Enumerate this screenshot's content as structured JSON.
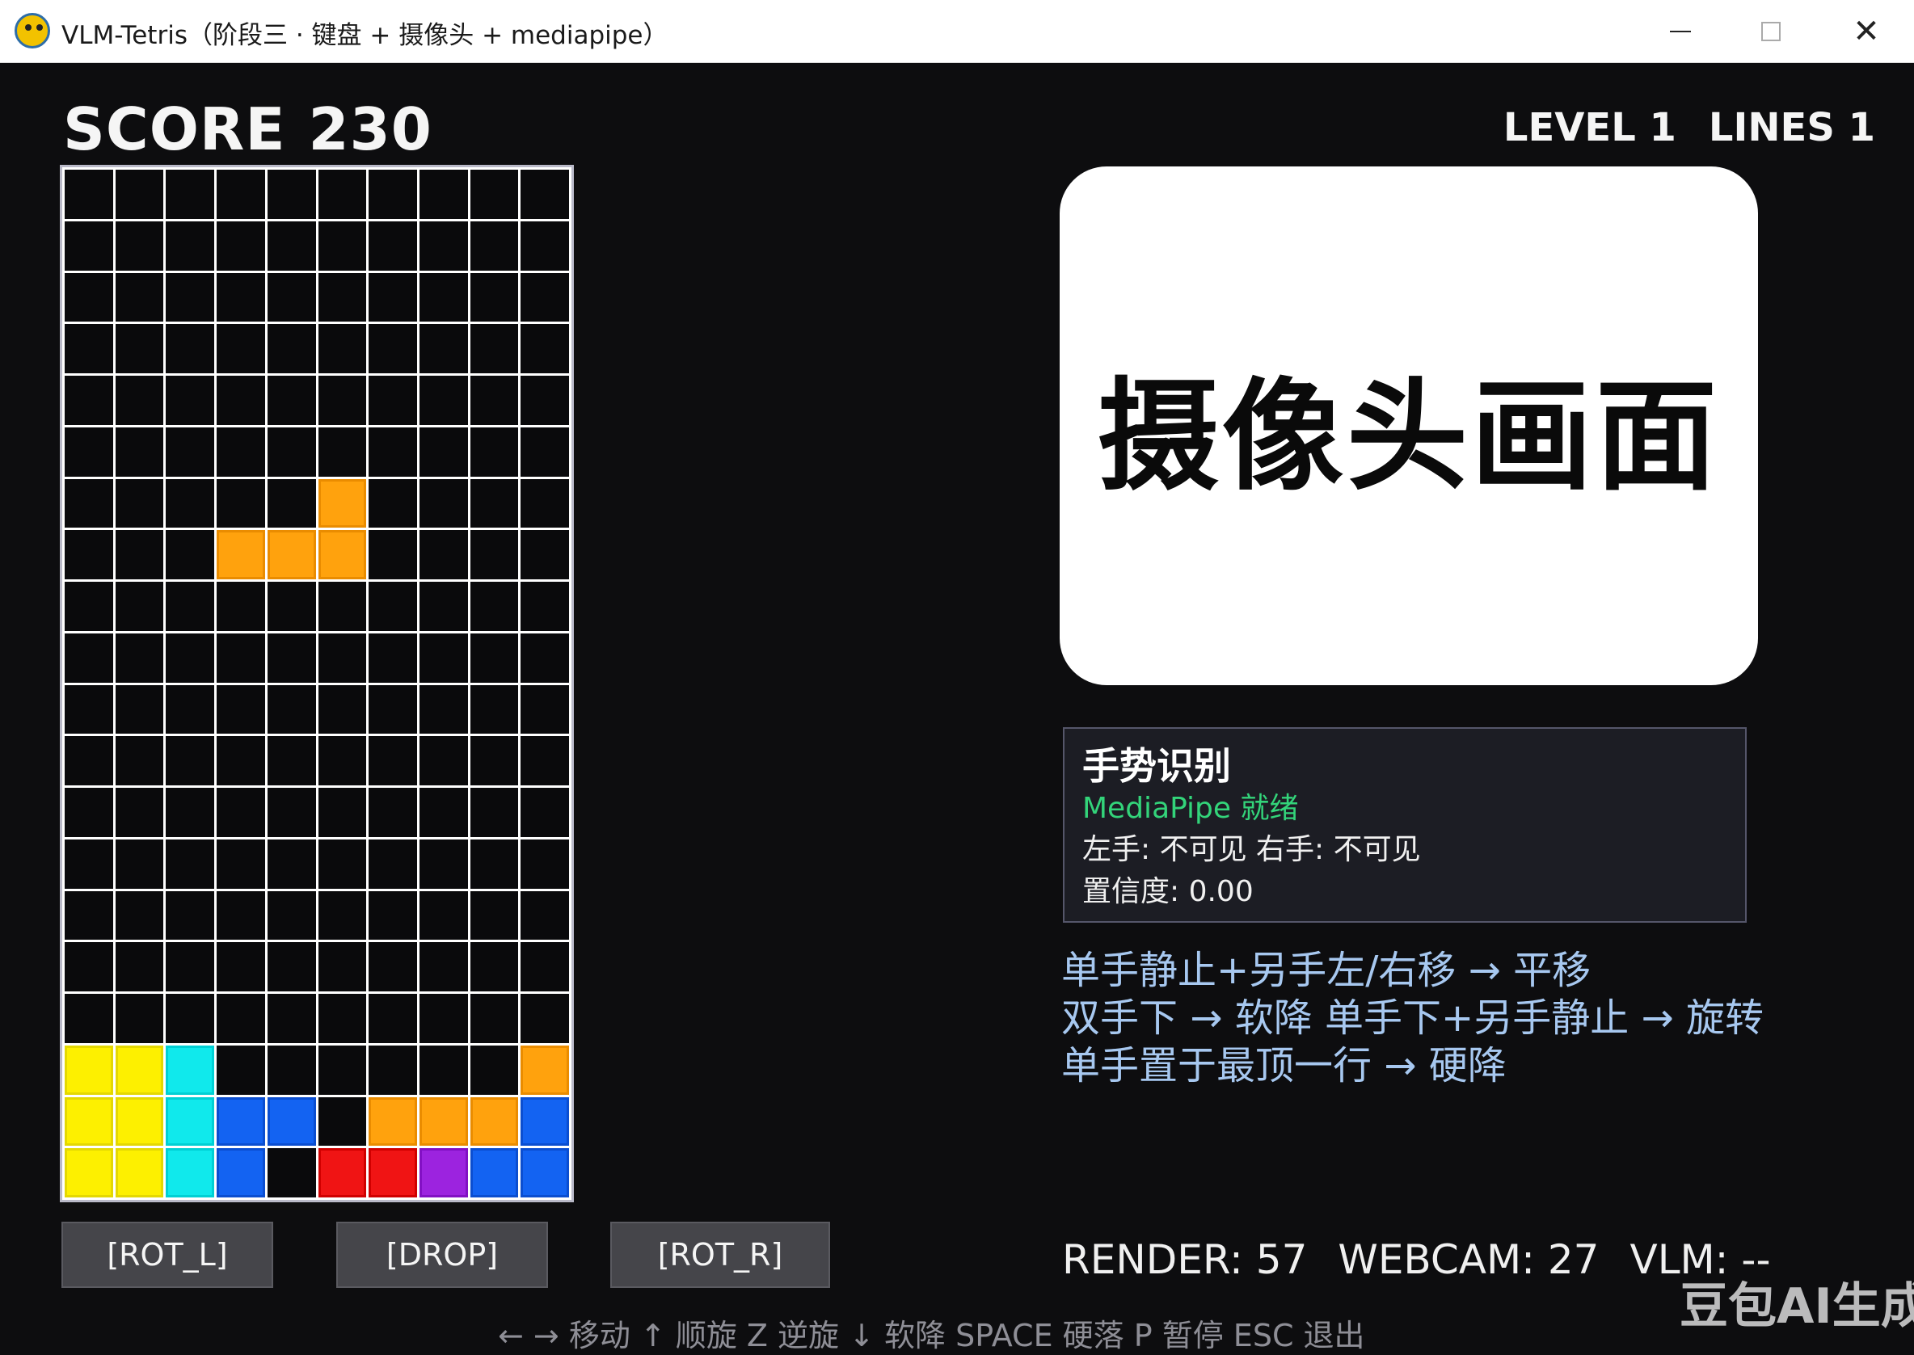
{
  "window": {
    "title": "VLM-Tetris（阶段三 · 键盘 + 摄像头 + mediapipe）",
    "minimize_icon": "minimize-icon",
    "maximize_icon": "maximize-icon",
    "close_icon": "close-icon",
    "close_glyph": "✕"
  },
  "hud": {
    "score_label": "SCORE",
    "score_value": "230",
    "level_label": "LEVEL 1",
    "lines_label": "LINES 1"
  },
  "board": {
    "rows": [
      "..........",
      "..........",
      "..........",
      "..........",
      "..........",
      "..........",
      ".....O....",
      "...OOO....",
      "..........",
      "..........",
      "..........",
      "..........",
      "..........",
      "..........",
      "..........",
      "..........",
      "..........",
      "YYC......O.",
      "YYCBB.OOOB",
      "YYCB.RRPBB"
    ],
    "colors": {
      "Y": "#fdf000",
      "C": "#10e9ec",
      "B": "#1363f2",
      "O": "#ffa20d",
      "R": "#f01414",
      "P": "#9c23df"
    }
  },
  "camera": {
    "label": "摄像头画面"
  },
  "gesture": {
    "title": "手势识别",
    "status": "MediaPipe 就绪",
    "hands": "左手: 不可见  右手: 不可见",
    "confidence": "置信度: 0.00"
  },
  "hints": [
    "单手静止+另手左/右移 → 平移",
    "双手下 → 软降    单手下+另手静止 → 旋转",
    "单手置于最顶一行 → 硬降"
  ],
  "buttons": {
    "rot_l": "[ROT_L]",
    "drop": "[DROP]",
    "rot_r": "[ROT_R]"
  },
  "stats": {
    "render": "RENDER: 57",
    "webcam": "WEBCAM: 27",
    "vlm": "VLM: --"
  },
  "keys": "← → 移动   ↑ 顺旋   Z 逆旋   ↓ 软降   SPACE 硬落   P 暂停   ESC 退出",
  "watermark": "豆包AI生成"
}
